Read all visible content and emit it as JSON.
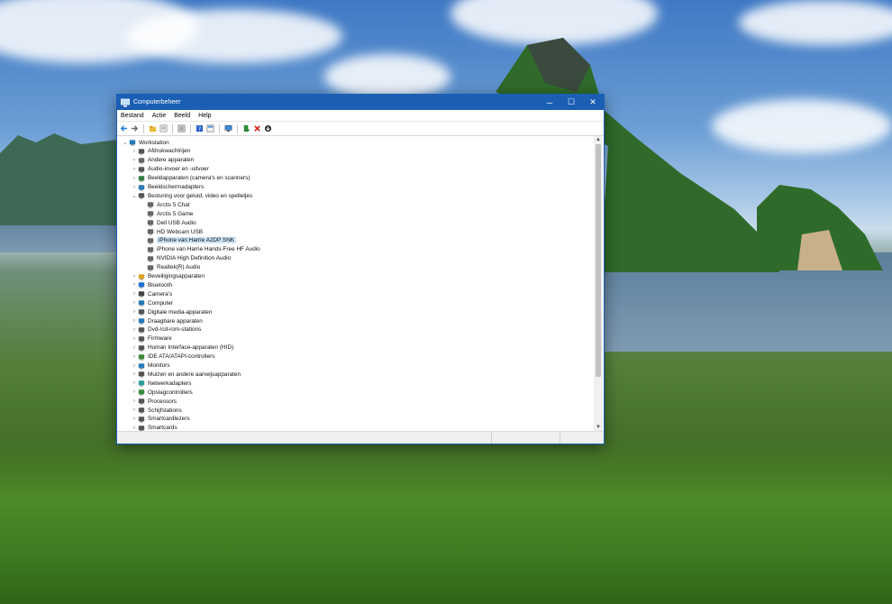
{
  "window": {
    "title": "Computerbeheer",
    "controls": {
      "minimize": "─",
      "maximize": "☐",
      "close": "✕"
    }
  },
  "menu": [
    "Bestand",
    "Actie",
    "Beeld",
    "Help"
  ],
  "toolbar_icons": [
    "back-icon",
    "forward-icon",
    "folder-up-icon",
    "properties-icon",
    "export-icon",
    "help-icon",
    "view-icon",
    "monitor-icon",
    "update-driver-icon",
    "uninstall-icon",
    "download-icon"
  ],
  "tree": {
    "root": "Workstation",
    "categories": [
      {
        "label": "Afdrukwachtrijen",
        "icon": "printer-icon",
        "color": "#555555"
      },
      {
        "label": "Andere apparaten",
        "icon": "unknown-device-icon",
        "color": "#666666"
      },
      {
        "label": "Audio-invoer en -uitvoer",
        "icon": "speaker-icon",
        "color": "#555555"
      },
      {
        "label": "Beeldapparaten (camera's en scanners)",
        "icon": "camera-icon",
        "color": "#2f7f3f"
      },
      {
        "label": "Beeldschermadapters",
        "icon": "display-adapter-icon",
        "color": "#2a7ab8"
      },
      {
        "label": "Besturing voor geluid, video en spelletjes",
        "icon": "sound-icon",
        "color": "#555555",
        "expanded": true,
        "children": [
          "Arctis 5 Chat",
          "Arctis 5 Game",
          "Dell USB Audio",
          "HD Webcam USB",
          "iPhone van Harrie A2DP SNK",
          "iPhone van Harrie Hands-Free HF Audio",
          "NVIDIA High Definition Audio",
          "Realtek(R) Audio"
        ],
        "selected_child": 4
      },
      {
        "label": "Beveiligingsapparaten",
        "icon": "security-icon",
        "color": "#d9a12a"
      },
      {
        "label": "Bluetooth",
        "icon": "bluetooth-icon",
        "color": "#1e6fd0"
      },
      {
        "label": "Camera's",
        "icon": "webcam-icon",
        "color": "#444444"
      },
      {
        "label": "Computer",
        "icon": "computer-icon",
        "color": "#2a7ab8"
      },
      {
        "label": "Digitale media-apparaten",
        "icon": "media-icon",
        "color": "#555555"
      },
      {
        "label": "Draagbare apparaten",
        "icon": "portable-icon",
        "color": "#2a7ab8"
      },
      {
        "label": "Dvd-/cd-rom-stations",
        "icon": "dvd-icon",
        "color": "#555555"
      },
      {
        "label": "Firmware",
        "icon": "firmware-icon",
        "color": "#555555"
      },
      {
        "label": "Human Interface-apparaten (HID)",
        "icon": "hid-icon",
        "color": "#555555"
      },
      {
        "label": "IDE ATA/ATAPI-controllers",
        "icon": "ide-icon",
        "color": "#3a8a3a"
      },
      {
        "label": "Monitors",
        "icon": "monitor-icon",
        "color": "#2a7ab8"
      },
      {
        "label": "Muizen en andere aanwijsapparaten",
        "icon": "mouse-icon",
        "color": "#555555"
      },
      {
        "label": "Netwerkadapters",
        "icon": "network-icon",
        "color": "#2a9a9a"
      },
      {
        "label": "Opslagcontrollers",
        "icon": "storage-icon",
        "color": "#3a8a3a"
      },
      {
        "label": "Processors",
        "icon": "cpu-icon",
        "color": "#555555"
      },
      {
        "label": "Schijfstations",
        "icon": "disk-icon",
        "color": "#555555"
      },
      {
        "label": "Smartcardlezers",
        "icon": "smartcard-reader-icon",
        "color": "#555555"
      },
      {
        "label": "Smartcards",
        "icon": "smartcard-icon",
        "color": "#555555"
      }
    ]
  },
  "colors": {
    "titlebar": "#1a5fb4",
    "selection": "#cce4f7"
  }
}
